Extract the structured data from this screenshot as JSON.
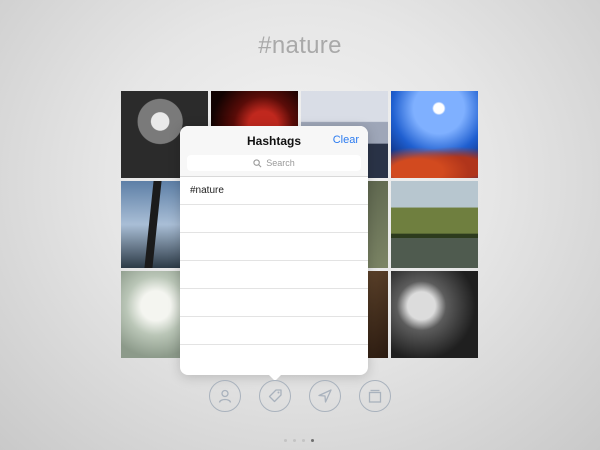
{
  "page_title": "#nature",
  "popover": {
    "title": "Hashtags",
    "clear_label": "Clear",
    "search_placeholder": "Search",
    "rows": [
      "#nature",
      "",
      "",
      "",
      "",
      "",
      ""
    ]
  },
  "toolbar": {
    "icons": [
      "user-icon",
      "tag-icon",
      "navigation-arrow-icon",
      "stack-icon"
    ]
  },
  "page_indicator": {
    "count": 4,
    "current": 4
  },
  "colors": {
    "accent": "#2b7bf0",
    "icon_stroke": "#a9b2bd",
    "title": "#a9a9a9"
  }
}
